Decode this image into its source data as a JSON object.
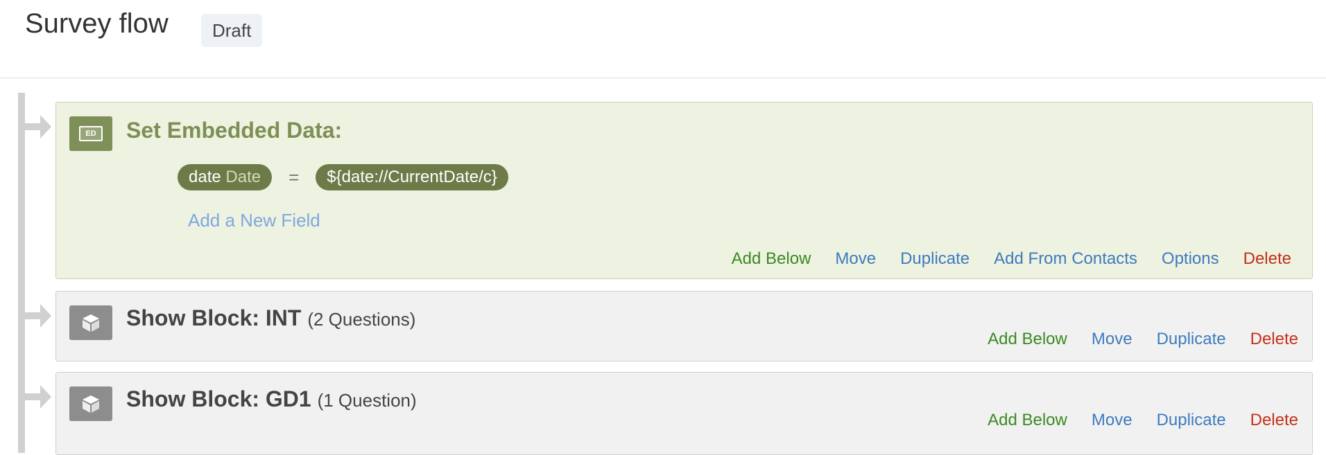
{
  "header": {
    "title": "Survey flow",
    "status": "Draft"
  },
  "embedded": {
    "icon_text": "ED",
    "title": "Set Embedded Data:",
    "field_name": "date",
    "field_type": "Date",
    "equals": "=",
    "field_value": "${date://CurrentDate/c}",
    "add_field": "Add a New Field",
    "actions": {
      "add_below": "Add Below",
      "move": "Move",
      "duplicate": "Duplicate",
      "add_from_contacts": "Add From Contacts",
      "options": "Options",
      "delete": "Delete"
    }
  },
  "blocks": [
    {
      "title": "Show Block: INT",
      "count": "(2 Questions)",
      "actions": {
        "add_below": "Add Below",
        "move": "Move",
        "duplicate": "Duplicate",
        "delete": "Delete"
      }
    },
    {
      "title": "Show Block: GD1",
      "count": "(1 Question)",
      "actions": {
        "add_below": "Add Below",
        "move": "Move",
        "duplicate": "Duplicate",
        "delete": "Delete"
      }
    }
  ],
  "colors": {
    "embedded_bg": "#edf2e1",
    "embedded_accent": "#7e8f55",
    "add_below": "#3a8a22",
    "link_blue": "#3e7bbd",
    "delete": "#c4301a"
  },
  "icons": {
    "embedded": "embedded-data-icon",
    "block": "block-cube-icon"
  }
}
